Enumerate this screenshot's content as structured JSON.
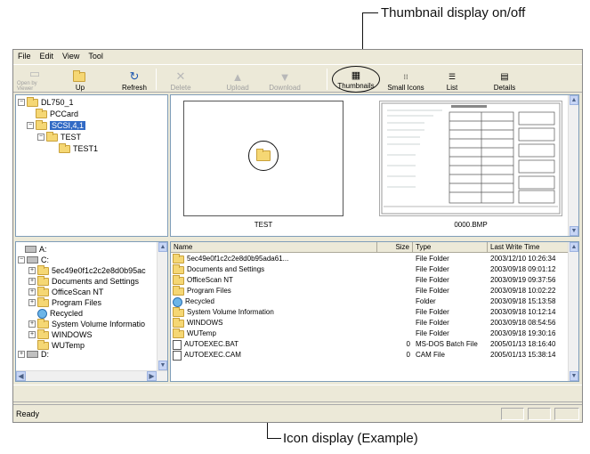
{
  "callouts": {
    "thumbnail_toggle": "Thumbnail display on/off",
    "icon_example": "Icon display (Example)"
  },
  "menu": [
    "File",
    "Edit",
    "View",
    "Tool"
  ],
  "toolbar": {
    "open_by_viewer": "Open by Viewer",
    "up": "Up",
    "refresh": "Refresh",
    "delete": "Delete",
    "upload": "Upload",
    "download": "Download",
    "thumbnails": "Thumbnails",
    "small_icons": "Small Icons",
    "list": "List",
    "details": "Details"
  },
  "tree": {
    "root": "DL750_1",
    "pccard": "PCCard",
    "scsi": "SCSI,4,1",
    "test": "TEST",
    "test1": "TEST1"
  },
  "thumbnails": [
    {
      "caption": "TEST",
      "icon": "folder-icon"
    },
    {
      "caption": "0000.BMP",
      "icon": "bmp-thumbnail"
    }
  ],
  "drives": [
    {
      "label": "A:",
      "icon": "floppy-drive-icon"
    },
    {
      "label": "C:",
      "icon": "hard-drive-icon"
    },
    {
      "label": "5ec49e0f1c2c2e8d0b95ac",
      "icon": "folder-icon"
    },
    {
      "label": "Documents and Settings",
      "icon": "folder-icon"
    },
    {
      "label": "OfficeScan NT",
      "icon": "folder-icon"
    },
    {
      "label": "Program Files",
      "icon": "folder-icon"
    },
    {
      "label": "Recycled",
      "icon": "recycle-bin-icon"
    },
    {
      "label": "System Volume Informatio",
      "icon": "folder-icon"
    },
    {
      "label": "WINDOWS",
      "icon": "folder-icon"
    },
    {
      "label": "WUTemp",
      "icon": "folder-icon"
    },
    {
      "label": "D:",
      "icon": "drive-icon"
    }
  ],
  "file_list": {
    "columns": [
      "Name",
      "Size",
      "Type",
      "Last Write Time"
    ],
    "rows": [
      {
        "name": "5ec49e0f1c2c2e8d0b95ada61...",
        "size": "",
        "type": "File Folder",
        "time": "2003/12/10 10:26:34",
        "icon": "folder-icon"
      },
      {
        "name": "Documents and Settings",
        "size": "",
        "type": "File Folder",
        "time": "2003/09/18 09:01:12",
        "icon": "folder-icon"
      },
      {
        "name": "OfficeScan NT",
        "size": "",
        "type": "File Folder",
        "time": "2003/09/19 09:37:56",
        "icon": "folder-icon"
      },
      {
        "name": "Program Files",
        "size": "",
        "type": "File Folder",
        "time": "2003/09/18 10:02:22",
        "icon": "folder-icon"
      },
      {
        "name": "Recycled",
        "size": "",
        "type": "Folder",
        "time": "2003/09/18 15:13:58",
        "icon": "recycle-bin-icon"
      },
      {
        "name": "System Volume Information",
        "size": "",
        "type": "File Folder",
        "time": "2003/09/18 10:12:14",
        "icon": "folder-icon"
      },
      {
        "name": "WINDOWS",
        "size": "",
        "type": "File Folder",
        "time": "2003/09/18 08:54:56",
        "icon": "folder-icon"
      },
      {
        "name": "WUTemp",
        "size": "",
        "type": "File Folder",
        "time": "2003/09/18 19:30:16",
        "icon": "folder-icon"
      },
      {
        "name": "AUTOEXEC.BAT",
        "size": "0",
        "type": "MS-DOS Batch File",
        "time": "2005/01/13 18:16:40",
        "icon": "batch-file-icon"
      },
      {
        "name": "AUTOEXEC.CAM",
        "size": "0",
        "type": "CAM File",
        "time": "2005/01/13 15:38:14",
        "icon": "file-icon"
      }
    ]
  },
  "status": "Ready"
}
